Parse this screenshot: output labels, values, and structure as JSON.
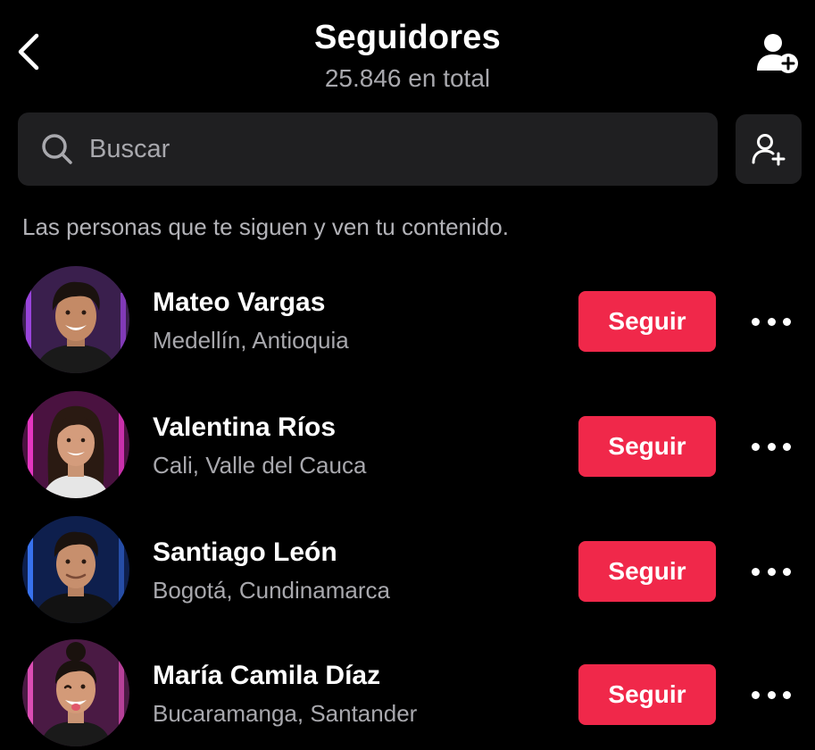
{
  "header": {
    "title": "Seguidores",
    "subtitle": "25.846 en total",
    "back_icon": "chevron-left-icon",
    "add_user_icon": "add-user-icon"
  },
  "search": {
    "placeholder": "Buscar",
    "icon": "search-icon",
    "side_button_icon": "add-user-icon"
  },
  "description": "Las personas que te siguen y ven tu contenido.",
  "followers": [
    {
      "name": "Mateo Vargas",
      "location": "Medellín, Antioquia",
      "button_label": "Seguir",
      "avatar_bg": "#3a1f4d",
      "avatar_glow": "#b14dff"
    },
    {
      "name": "Valentina Ríos",
      "location": "Cali, Valle del Cauca",
      "button_label": "Seguir",
      "avatar_bg": "#4a1240",
      "avatar_glow": "#ff3dd8"
    },
    {
      "name": "Santiago León",
      "location": "Bogotá, Cundinamarca",
      "button_label": "Seguir",
      "avatar_bg": "#0e1f4d",
      "avatar_glow": "#3d7bff"
    },
    {
      "name": "María Camila Díaz",
      "location": "Bucaramanga, Santander",
      "button_label": "Seguir",
      "avatar_bg": "#4a1a44",
      "avatar_glow": "#ff5ad0"
    }
  ],
  "colors": {
    "background": "#000000",
    "surface": "#1f1f21",
    "accent": "#f0284a",
    "secondary_text": "#a8a8ad"
  }
}
